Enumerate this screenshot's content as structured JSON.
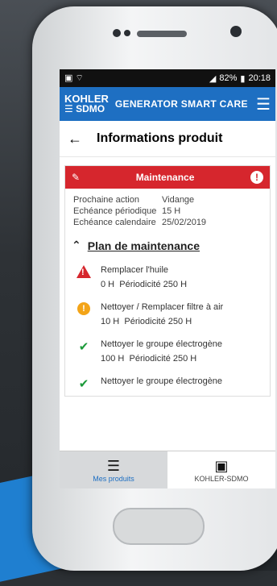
{
  "status": {
    "battery": "82%",
    "time": "20:18"
  },
  "appbar": {
    "logo_top": "KOHLER",
    "logo_bottom": "SDMO",
    "title": "GENERATOR SMART CARE"
  },
  "page": {
    "title": "Informations produit"
  },
  "card": {
    "title": "Maintenance",
    "rows": [
      {
        "k": "Prochaine action",
        "v": "Vidange"
      },
      {
        "k": "Echéance périodique",
        "v": "15 H"
      },
      {
        "k": "Echéance calendaire",
        "v": "25/02/2019"
      }
    ]
  },
  "plan": {
    "label": "Plan de maintenance"
  },
  "tasks": [
    {
      "title": "Remplacer l'huile",
      "hours": "0 H",
      "period": "Périodicité 250 H",
      "status": "danger"
    },
    {
      "title": "Nettoyer / Remplacer  filtre à air",
      "hours": "10 H",
      "period": "Périodicité 250 H",
      "status": "warning"
    },
    {
      "title": "Nettoyer le groupe électrogène",
      "hours": "100 H",
      "period": "Périodicité 250 H",
      "status": "ok"
    },
    {
      "title": "Nettoyer le groupe électrogène",
      "hours": "",
      "period": "",
      "status": "ok"
    }
  ],
  "nav": {
    "left": "Mes produits",
    "right": "KOHLER-SDMO"
  },
  "colors": {
    "appbar": "#1e6fc2",
    "danger": "#d6262d",
    "warning": "#f3a418",
    "ok": "#1c9a3a"
  }
}
